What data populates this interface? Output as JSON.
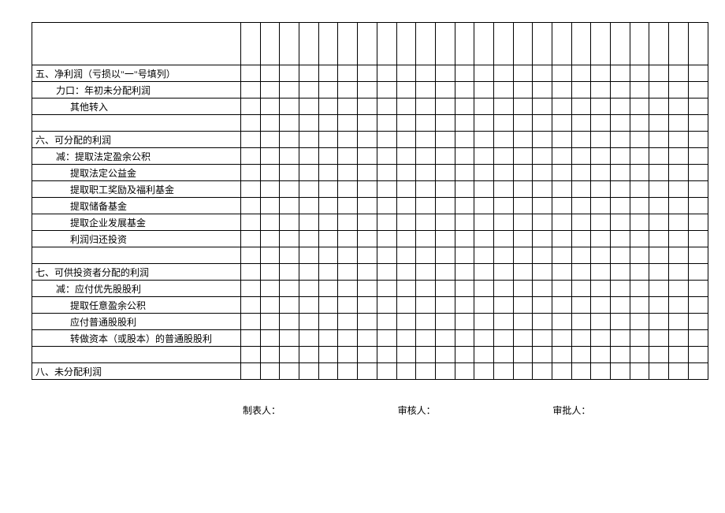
{
  "rows": [
    {
      "label": "",
      "cls": "label tall"
    },
    {
      "label": "五、净利润（亏损以\"一\"号填列）",
      "cls": "label"
    },
    {
      "label": "力口：年初未分配利润",
      "cls": "label indent"
    },
    {
      "label": "其他转入",
      "cls": "label indent2"
    },
    {
      "label": "",
      "cls": "label"
    },
    {
      "label": "六、可分配的利润",
      "cls": "label"
    },
    {
      "label": "减：提取法定盈余公积",
      "cls": "label indent"
    },
    {
      "label": "提取法定公益金",
      "cls": "label indent2"
    },
    {
      "label": "提取职工奖励及福利基金",
      "cls": "label indent2"
    },
    {
      "label": "提取储备基金",
      "cls": "label indent2"
    },
    {
      "label": "提取企业发展基金",
      "cls": "label indent2"
    },
    {
      "label": "利润归还投资",
      "cls": "label indent2"
    },
    {
      "label": "",
      "cls": "label"
    },
    {
      "label": "七、可供投资者分配的利润",
      "cls": "label"
    },
    {
      "label": "减：应付优先股股利",
      "cls": "label indent"
    },
    {
      "label": "提取任意盈余公积",
      "cls": "label indent2"
    },
    {
      "label": "应付普通股股利",
      "cls": "label indent2"
    },
    {
      "label": "转做资本（或股本）的普通股股利",
      "cls": "label indent2"
    },
    {
      "label": "",
      "cls": "label"
    },
    {
      "label": "八、未分配利润",
      "cls": "label"
    }
  ],
  "narrow_cols": 24,
  "footer": {
    "preparer": "制表人：",
    "reviewer": "审核人：",
    "approver": "审批人："
  }
}
